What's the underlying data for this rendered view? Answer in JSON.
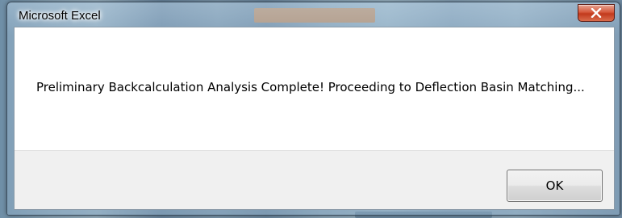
{
  "dialog": {
    "title": "Microsoft Excel",
    "close_icon": "close-icon",
    "message": "Preliminary Backcalculation Analysis Complete! Proceeding to Deflection Basin Matching...",
    "ok_label": "OK"
  },
  "colors": {
    "close_button": "#c2391c",
    "content_background": "#ffffff",
    "footer_background": "#f0f0f0"
  }
}
